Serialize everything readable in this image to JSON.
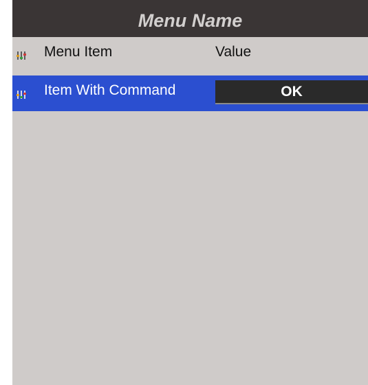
{
  "menu": {
    "title": "Menu Name",
    "items": [
      {
        "label": "Menu Item",
        "value": "Value",
        "icon": "equalizer-icon",
        "selected": false
      },
      {
        "label": "Item With Command",
        "button_label": "OK",
        "icon": "equalizer-icon",
        "selected": true
      }
    ]
  },
  "colors": {
    "header_background": "#3a3535",
    "header_text": "#d2cfce",
    "panel_background": "#cfcbc9",
    "selection_background": "#2b4fd0",
    "button_background": "#2a2a2a",
    "button_text": "#ffffff"
  }
}
